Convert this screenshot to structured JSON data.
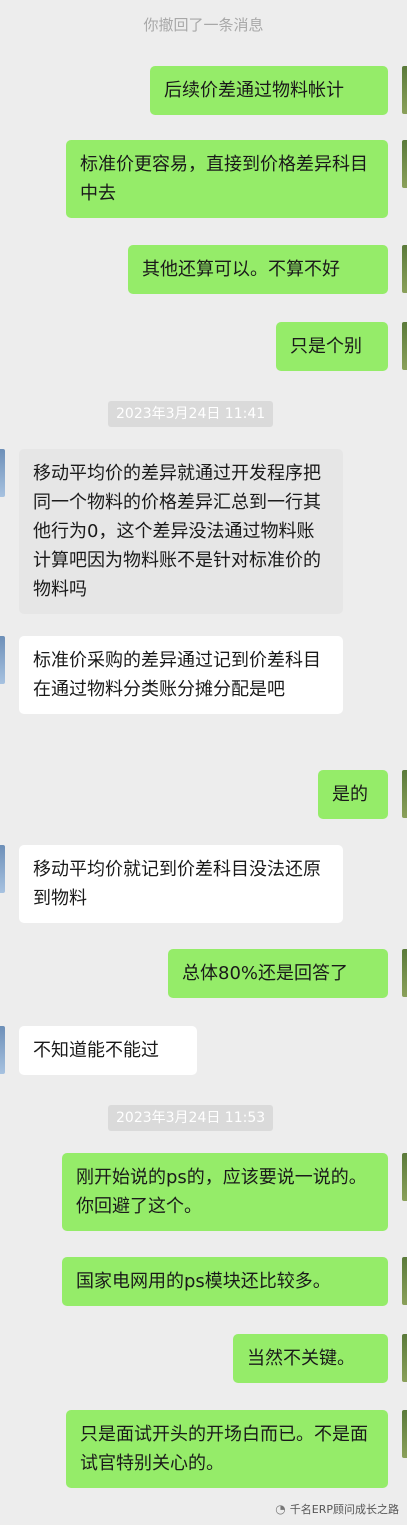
{
  "system_notice": "你撤回了一条消息",
  "timestamps": [
    "2023年3月24日 11:41",
    "2023年3月24日 11:53"
  ],
  "messages": [
    {
      "text": "后续价差通过物料帐计"
    },
    {
      "text": "标准价更容易，直接到价格差异科目中去"
    },
    {
      "text": "其他还算可以。不算不好"
    },
    {
      "text": "只是个别"
    },
    {
      "text": "移动平均价的差异就通过开发程序把同一个物料的价格差异汇总到一行其他行为0，这个差异没法通过物料账计算吧因为物料账不是针对标准价的物料吗"
    },
    {
      "text": "标准价采购的差异通过记到价差科目在通过物料分类账分摊分配是吧"
    },
    {
      "text": "是的"
    },
    {
      "text": "移动平均价就记到价差科目没法还原到物料"
    },
    {
      "text": "总体80%还是回答了"
    },
    {
      "text": "不知道能不能过"
    },
    {
      "text": "刚开始说的ps的，应该要说一说的。你回避了这个。"
    },
    {
      "text": "国家电网用的ps模块还比较多。"
    },
    {
      "text": "当然不关键。"
    },
    {
      "text": "只是面试开头的开场白而已。不是面试官特别关心的。"
    }
  ],
  "watermark": "千名ERP顾问成长之路",
  "colors": {
    "outgoing": "#95ec69",
    "incoming": "#ffffff",
    "background": "#ededed"
  }
}
